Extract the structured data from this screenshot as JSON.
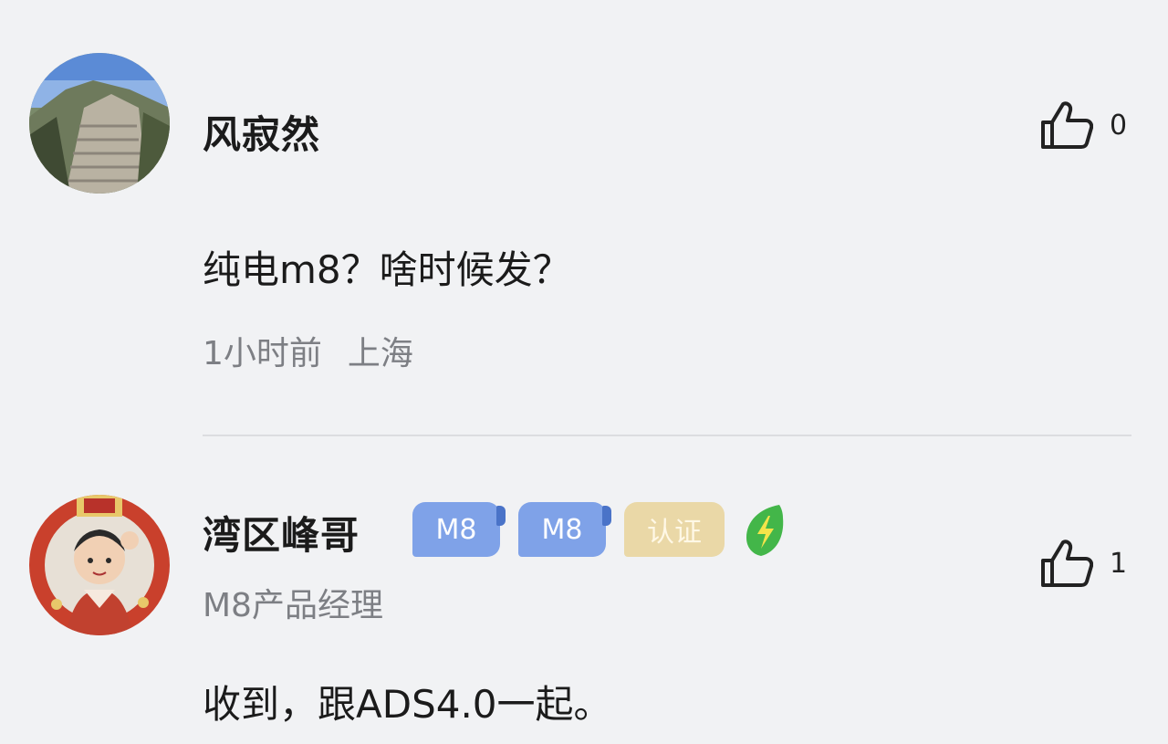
{
  "comments": [
    {
      "username": "风寂然",
      "text": "纯电m8？啥时候发？",
      "time": "1小时前",
      "location": "上海",
      "likes": "0",
      "avatar_icon": "great-wall-photo-avatar"
    },
    {
      "username": "湾区峰哥",
      "badges": [
        "M8",
        "M8",
        "认证"
      ],
      "verified_icon": "green-leaf-lightning-icon",
      "title": "M8产品经理",
      "text": "收到，跟ADS4.0一起。",
      "likes": "1",
      "avatar_icon": "cartoon-character-avatar"
    }
  ],
  "icons": {
    "like": "thumbs-up-icon"
  },
  "colors": {
    "background": "#f1f2f4",
    "meta_text": "#7d7f84",
    "badge_blue": "#7fa2e8",
    "badge_gold": "#ead8a7",
    "leaf_green": "#43b649"
  }
}
